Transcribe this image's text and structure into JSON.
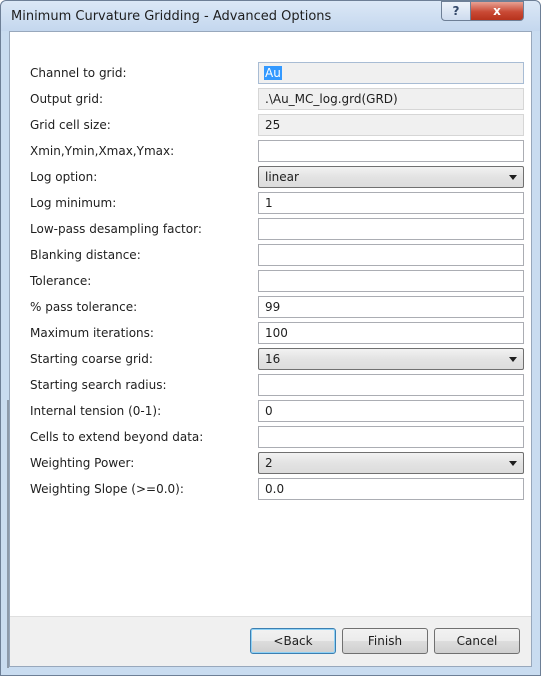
{
  "window": {
    "title": "Minimum Curvature Gridding - Advanced Options",
    "help_glyph": "?",
    "close_glyph": "x"
  },
  "form": {
    "channel_to_grid": {
      "label": "Channel to grid:",
      "value": "Au"
    },
    "output_grid": {
      "label": "Output grid:",
      "value": ".\\Au_MC_log.grd(GRD)"
    },
    "grid_cell_size": {
      "label": "Grid cell size:",
      "value": "25"
    },
    "extents": {
      "label": "Xmin,Ymin,Xmax,Ymax:",
      "value": ""
    },
    "log_option": {
      "label": "Log option:",
      "value": "linear"
    },
    "log_minimum": {
      "label": "Log minimum:",
      "value": "1"
    },
    "low_pass_factor": {
      "label": "Low-pass desampling factor:",
      "value": ""
    },
    "blanking_distance": {
      "label": "Blanking distance:",
      "value": ""
    },
    "tolerance": {
      "label": "Tolerance:",
      "value": ""
    },
    "pass_tolerance": {
      "label": "% pass tolerance:",
      "value": "99"
    },
    "max_iterations": {
      "label": "Maximum iterations:",
      "value": "100"
    },
    "coarse_grid": {
      "label": "Starting coarse grid:",
      "value": "16"
    },
    "search_radius": {
      "label": "Starting search radius:",
      "value": ""
    },
    "internal_tension": {
      "label": "Internal tension (0-1):",
      "value": "0"
    },
    "cells_extend": {
      "label": "Cells to extend beyond data:",
      "value": ""
    },
    "weighting_power": {
      "label": "Weighting Power:",
      "value": "2"
    },
    "weighting_slope": {
      "label": "Weighting Slope (>=0.0):",
      "value": "0.0"
    }
  },
  "buttons": {
    "back": "<Back",
    "finish": "Finish",
    "cancel": "Cancel"
  },
  "icons": {
    "help": "help-icon",
    "close": "close-icon",
    "dropdown": "chevron-down-icon"
  },
  "colors": {
    "title_bar": "#c9dcf0",
    "close_button": "#c94a35",
    "selection": "#3399ff",
    "readonly_field": "#f0f0f0"
  }
}
